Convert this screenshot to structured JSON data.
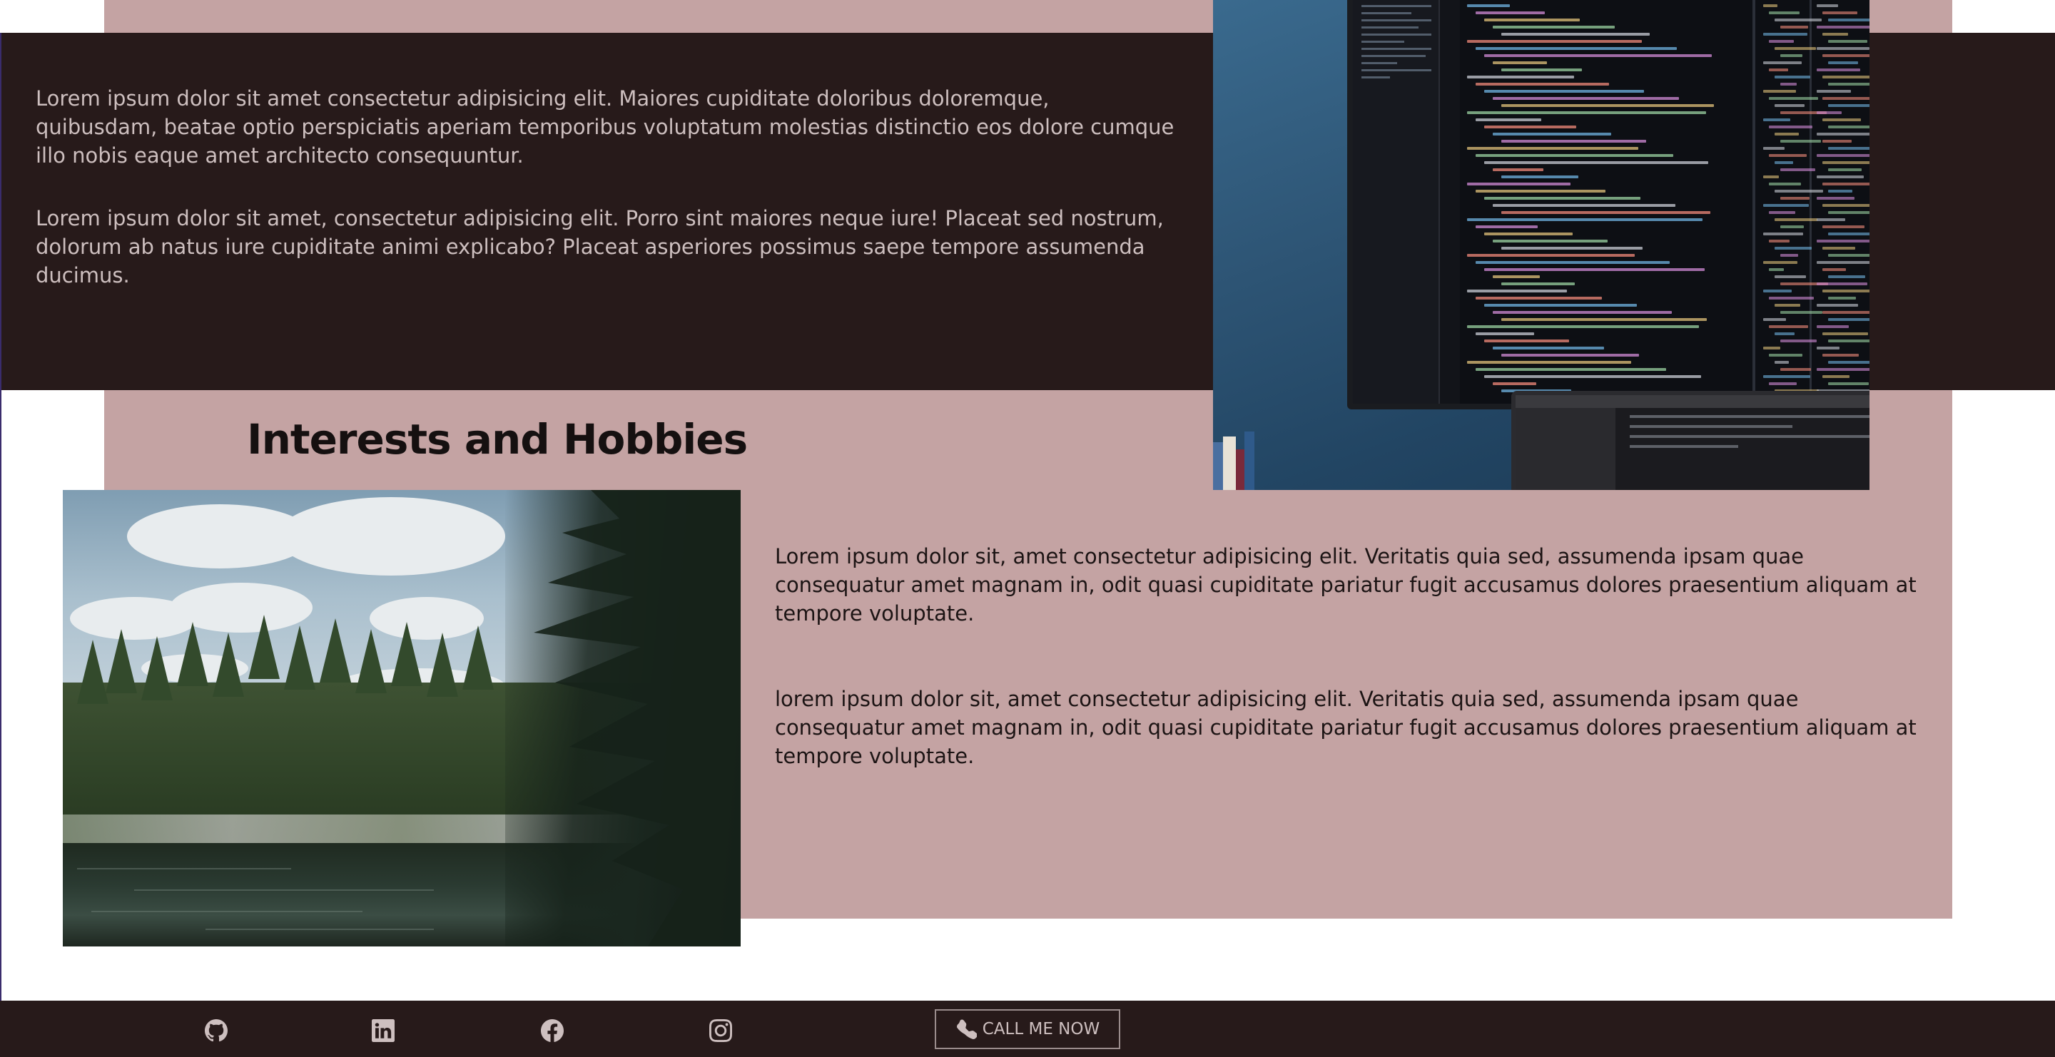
{
  "about": {
    "paragraph1": "Lorem ipsum dolor sit amet consectetur adipisicing elit. Maiores cupiditate doloribus doloremque, quibusdam, beatae optio perspiciatis aperiam temporibus voluptatum molestias distinctio eos dolore cumque illo nobis eaque amet architecto consequuntur.",
    "paragraph2": "Lorem ipsum dolor sit amet, consectetur adipisicing elit. Porro sint maiores neque iure! Placeat sed nostrum, dolorum ab natus iure cupiditate animi explicabo? Placeat asperiores possimus saepe tempore assumenda ducimus."
  },
  "hobbies": {
    "title": "Interests and Hobbies",
    "paragraph1": "Lorem ipsum dolor sit, amet consectetur adipisicing elit. Veritatis quia sed, assumenda ipsam quae consequatur amet magnam in, odit quasi cupiditate pariatur fugit accusamus dolores praesentium aliquam at tempore voluptate.",
    "paragraph2": "lorem ipsum dolor sit, amet consectetur adipisicing elit. Veritatis quia sed, assumenda ipsam quae consequatur amet magnam in, odit quasi cupiditate pariatur fugit accusamus dolores praesentium aliquam at tempore voluptate."
  },
  "footer": {
    "social": [
      "github-icon",
      "linkedin-icon",
      "facebook-icon",
      "instagram-icon"
    ],
    "call_button_label": "CALL ME NOW"
  },
  "colors": {
    "dark": "#271a1a",
    "pink": "#c4a3a3",
    "light_text": "#cdbfbf"
  }
}
